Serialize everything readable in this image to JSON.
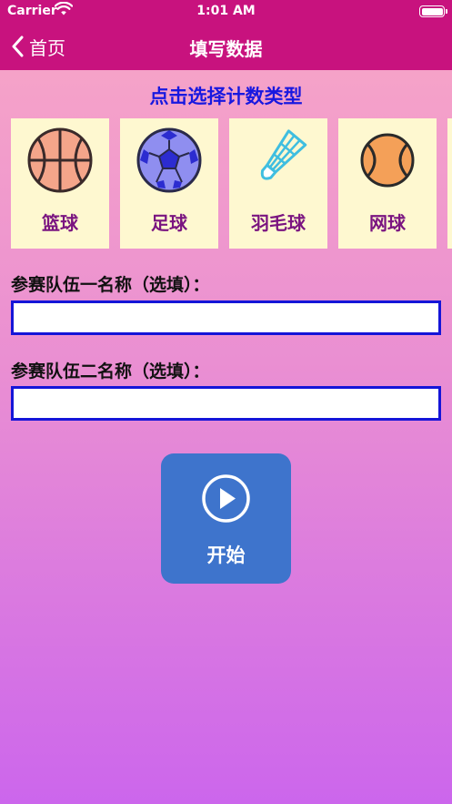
{
  "status_bar": {
    "carrier": "Carrier",
    "time": "1:01 AM"
  },
  "nav": {
    "back_label": "首页",
    "title": "填写数据"
  },
  "section": {
    "title": "点击选择计数类型"
  },
  "sports": [
    {
      "label": "篮球",
      "icon": "basketball-icon"
    },
    {
      "label": "足球",
      "icon": "soccer-ball-icon"
    },
    {
      "label": "羽毛球",
      "icon": "shuttlecock-icon"
    },
    {
      "label": "网球",
      "icon": "tennis-ball-icon"
    }
  ],
  "form": {
    "team1_label": "参赛队伍一名称（选填）：",
    "team1_value": "",
    "team2_label": "参赛队伍二名称（选填）：",
    "team2_value": ""
  },
  "start": {
    "label": "开始",
    "icon": "play-circle-icon"
  },
  "colors": {
    "nav_bg": "#c8127e",
    "section_title": "#1818e0",
    "card_bg": "#fef8d0",
    "card_label": "#7a1480",
    "input_border": "#1515d8",
    "start_bg": "#3e74cc"
  }
}
